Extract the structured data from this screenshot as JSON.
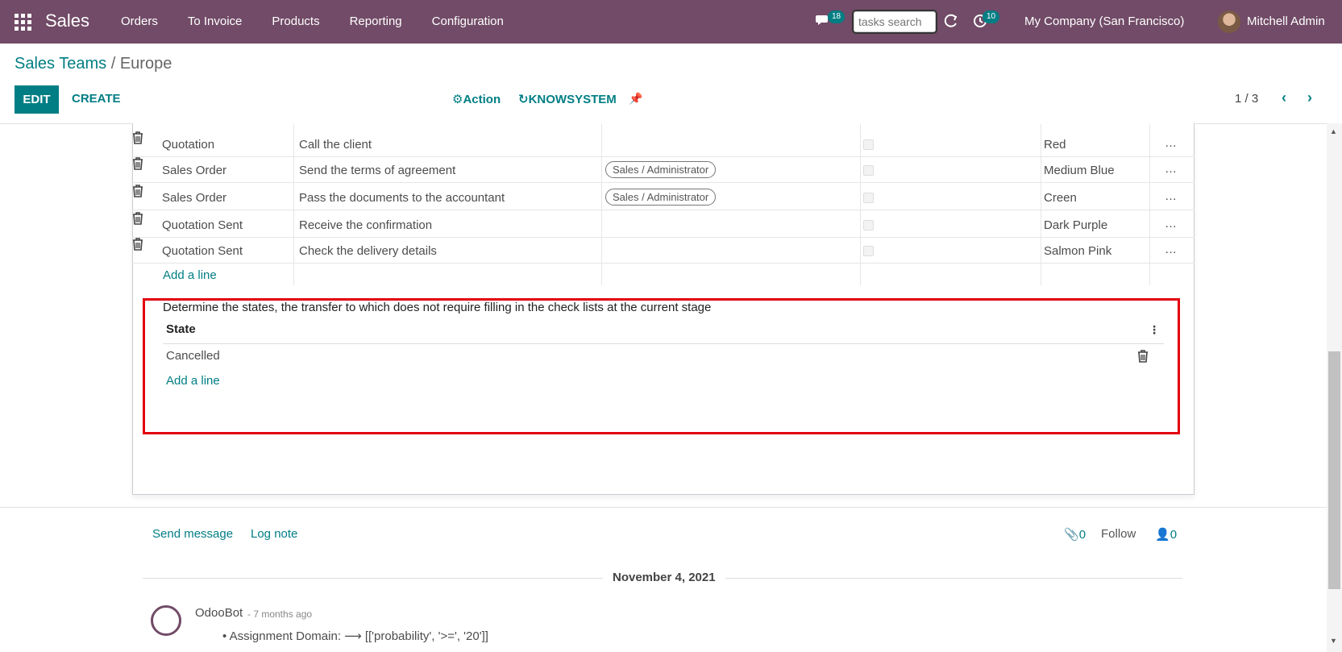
{
  "navbar": {
    "app_name": "Sales",
    "menu": [
      "Orders",
      "To Invoice",
      "Products",
      "Reporting",
      "Configuration"
    ],
    "messages_count": "18",
    "search_placeholder": "tasks search",
    "activities_count": "10",
    "company": "My Company (San Francisco)",
    "user": "Mitchell Admin"
  },
  "control_panel": {
    "breadcrumb_parent": "Sales Teams",
    "breadcrumb_sep": "/",
    "breadcrumb_current": "Europe",
    "edit_label": "EDIT",
    "create_label": "CREATE",
    "action_label": "Action",
    "knowsystem_label": "KNOWSYSTEM",
    "pager": "1 / 3"
  },
  "checklist": {
    "rows": [
      {
        "stage": "Quotation",
        "name": "Call the client",
        "group": "",
        "color": "Red"
      },
      {
        "stage": "Sales Order",
        "name": "Send the terms of agreement",
        "group": "Sales / Administrator",
        "color": "Medium Blue"
      },
      {
        "stage": "Sales Order",
        "name": "Pass the documents to the accountant",
        "group": "Sales / Administrator",
        "color": "Creen"
      },
      {
        "stage": "Quotation Sent",
        "name": "Receive the confirmation",
        "group": "",
        "color": "Dark Purple"
      },
      {
        "stage": "Quotation Sent",
        "name": "Check the delivery details",
        "group": "",
        "color": "Salmon Pink"
      }
    ],
    "add_line": "Add a line"
  },
  "states_section": {
    "title": "Determine the states, the transfer to which does not require filling in the check lists at the current stage",
    "column_header": "State",
    "rows": [
      "Cancelled"
    ],
    "add_line": "Add a line"
  },
  "chatter": {
    "send_message": "Send message",
    "log_note": "Log note",
    "attachments_count": "0",
    "follow": "Follow",
    "followers_count": "0",
    "date": "November 4, 2021",
    "author": "OdooBot",
    "time_ago": "- 7 months ago",
    "message": "Assignment Domain: ⟶ [['probability', '>=', '20']]"
  },
  "colors": {
    "navbar": "#714b67",
    "accent": "#017e84",
    "highlight": "#e3000f"
  }
}
